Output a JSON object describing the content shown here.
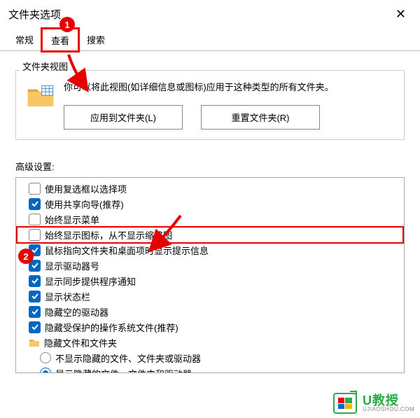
{
  "title": "文件夹选项",
  "tabs": [
    {
      "label": "常规"
    },
    {
      "label": "查看"
    },
    {
      "label": "搜索"
    }
  ],
  "view": {
    "group_label": "文件夹视图",
    "description": "你可以将此视图(如详细信息或图标)应用于这种类型的所有文件夹。",
    "apply_btn": "应用到文件夹(L)",
    "reset_btn": "重置文件夹(R)"
  },
  "advanced": {
    "label": "高级设置:",
    "items": [
      {
        "type": "checkbox",
        "checked": false,
        "label": "使用复选框以选择项"
      },
      {
        "type": "checkbox",
        "checked": true,
        "label": "使用共享向导(推荐)"
      },
      {
        "type": "checkbox",
        "checked": false,
        "label": "始终显示菜单"
      },
      {
        "type": "checkbox",
        "checked": false,
        "label": "始终显示图标，从不显示缩略图",
        "highlight": true
      },
      {
        "type": "checkbox",
        "checked": true,
        "label": "鼠标指向文件夹和桌面项时显示提示信息"
      },
      {
        "type": "checkbox",
        "checked": true,
        "label": "显示驱动器号"
      },
      {
        "type": "checkbox",
        "checked": true,
        "label": "显示同步提供程序通知"
      },
      {
        "type": "checkbox",
        "checked": true,
        "label": "显示状态栏"
      },
      {
        "type": "checkbox",
        "checked": true,
        "label": "隐藏空的驱动器"
      },
      {
        "type": "checkbox",
        "checked": true,
        "label": "隐藏受保护的操作系统文件(推荐)"
      },
      {
        "type": "folder",
        "label": "隐藏文件和文件夹"
      },
      {
        "type": "radio",
        "checked": false,
        "indent": 2,
        "label": "不显示隐藏的文件、文件夹或驱动器"
      },
      {
        "type": "radio",
        "checked": true,
        "indent": 2,
        "label": "显示隐藏的文件、文件夹和驱动器"
      }
    ]
  },
  "annotations": {
    "badge1": "1",
    "badge2": "2"
  },
  "watermark": {
    "cn": "U教授",
    "en": "UJIAOSHOU.COM"
  }
}
